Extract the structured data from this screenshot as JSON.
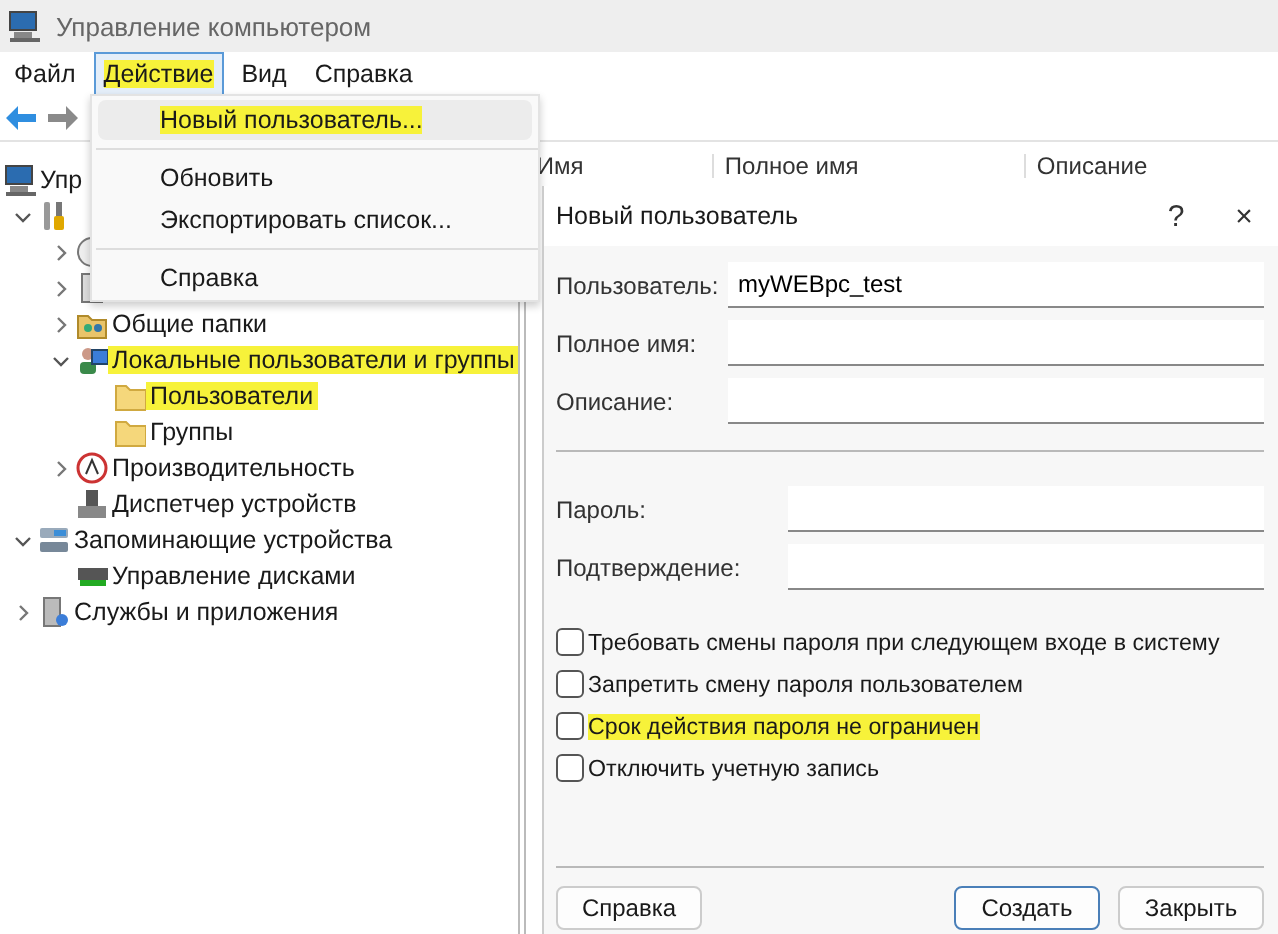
{
  "window": {
    "title": "Управление компьютером"
  },
  "menu_bar": [
    {
      "label": "Файл",
      "selected": false,
      "highlighted": false
    },
    {
      "label": "Действие",
      "selected": true,
      "highlighted": true
    },
    {
      "label": "Вид",
      "selected": false,
      "highlighted": false
    },
    {
      "label": "Справка",
      "selected": false,
      "highlighted": false
    }
  ],
  "tree": [
    {
      "label": "Упр",
      "kind": "computer",
      "selected": false,
      "highlighted": false,
      "children": [
        {
          "kind": "tools",
          "expanded": true,
          "children": [
            {
              "kind": "clock",
              "expanded": false
            },
            {
              "kind": "log",
              "expanded": false
            },
            {
              "label": "Общие папки",
              "kind": "share",
              "expanded": false,
              "selected": false,
              "highlighted": false
            },
            {
              "label": "Локальные пользователи и группы",
              "kind": "users",
              "expanded": true,
              "selected": false,
              "highlighted": true,
              "children": [
                {
                  "label": "Пользователи",
                  "kind": "folder",
                  "selected": true,
                  "highlighted": true
                },
                {
                  "label": "Группы",
                  "kind": "folder",
                  "selected": false,
                  "highlighted": false
                }
              ]
            },
            {
              "label": "Производительность",
              "kind": "perf",
              "expanded": false,
              "selected": false,
              "highlighted": false
            },
            {
              "label": "Диспетчер устройств",
              "kind": "device",
              "selected": false,
              "highlighted": false
            }
          ]
        },
        {
          "label": "Запоминающие устройства",
          "kind": "storage",
          "expanded": true,
          "selected": false,
          "highlighted": false,
          "children": [
            {
              "label": "Управление дисками",
              "kind": "disk",
              "selected": false,
              "highlighted": false
            }
          ]
        },
        {
          "label": "Службы и приложения",
          "kind": "services",
          "expanded": false,
          "selected": false,
          "highlighted": false
        }
      ]
    }
  ],
  "list_columns": [
    "Имя",
    "Полное имя",
    "Описание"
  ],
  "action_menu": [
    {
      "kind": "item",
      "label": "Новый пользователь...",
      "selected": true,
      "highlighted": true
    },
    {
      "kind": "separator"
    },
    {
      "kind": "item",
      "label": "Обновить",
      "selected": false,
      "highlighted": false
    },
    {
      "kind": "item",
      "label": "Экспортировать список...",
      "selected": false,
      "highlighted": false
    },
    {
      "kind": "separator"
    },
    {
      "kind": "item",
      "label": "Справка",
      "selected": false,
      "highlighted": false
    }
  ],
  "dialog": {
    "title": "Новый пользователь",
    "help_glyph": "?",
    "close_glyph": "×",
    "account_fields": [
      {
        "label": "Пользователь:",
        "value": "myWEBpc_test"
      },
      {
        "label": "Полное имя:"
      },
      {
        "label": "Описание:"
      }
    ],
    "password_fields": [
      {
        "label": "Пароль:"
      },
      {
        "label": "Подтверждение:"
      }
    ],
    "options": [
      {
        "label": "Требовать смены пароля при следующем входе в систему",
        "checked": false,
        "highlighted": false
      },
      {
        "label": "Запретить смену пароля пользователем",
        "checked": false,
        "highlighted": false
      },
      {
        "label": "Срок действия пароля не ограничен",
        "checked": false,
        "highlighted": true
      },
      {
        "label": "Отключить учетную запись",
        "checked": false,
        "highlighted": false
      }
    ],
    "buttons": [
      {
        "label": "Справка",
        "default": false
      },
      {
        "label": "Создать",
        "default": true
      },
      {
        "label": "Закрыть",
        "default": false
      }
    ]
  }
}
